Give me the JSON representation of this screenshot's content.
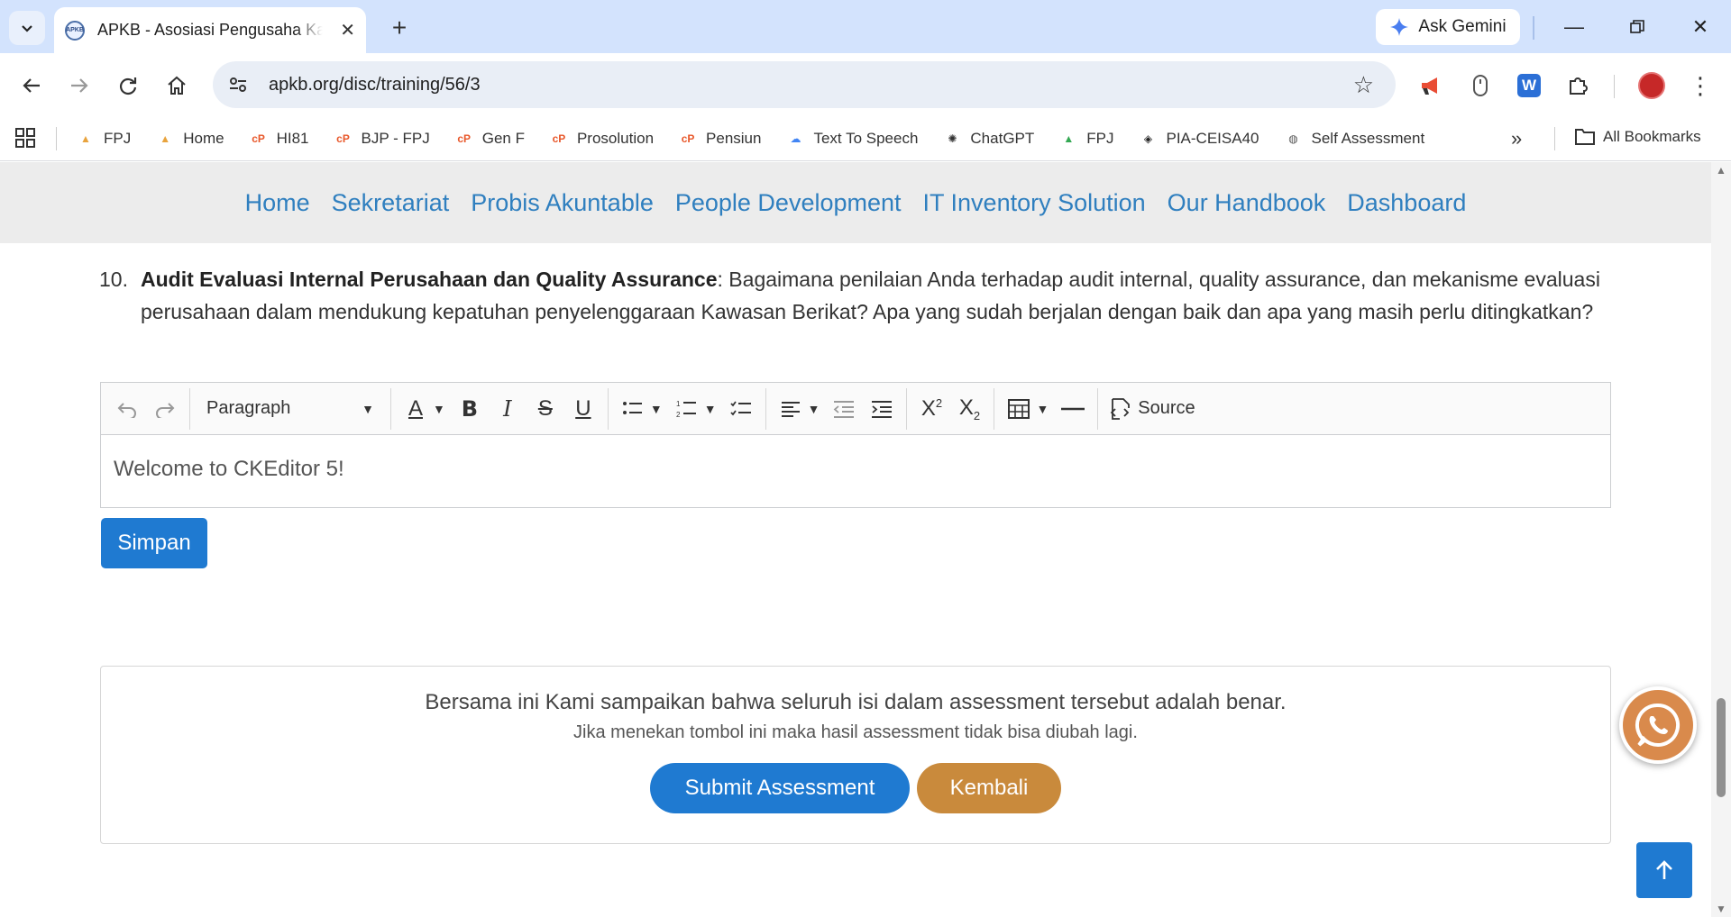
{
  "browser": {
    "tab_title": "APKB - Asosiasi Pengusaha Kawasan Berikat",
    "tab_favicon_text": "APKB",
    "ask_gemini": "Ask Gemini",
    "url": "apkb.org/disc/training/56/3",
    "ext_word_label": "W"
  },
  "bookmarks": [
    {
      "label": "FPJ",
      "icon": "pma-logo-icon",
      "color": "#e8a33d"
    },
    {
      "label": "Home",
      "icon": "pma-logo-icon",
      "color": "#e8a33d"
    },
    {
      "label": "HI81",
      "icon": "cp-logo-icon",
      "color": "#e8572a"
    },
    {
      "label": "BJP - FPJ",
      "icon": "cp-logo-icon",
      "color": "#e8572a"
    },
    {
      "label": "Gen F",
      "icon": "cp-logo-icon",
      "color": "#e8572a"
    },
    {
      "label": "Prosolution",
      "icon": "cp-logo-icon",
      "color": "#e8572a"
    },
    {
      "label": "Pensiun",
      "icon": "cp-logo-icon",
      "color": "#e8572a"
    },
    {
      "label": "Text To Speech",
      "icon": "cloud-icon",
      "color": "#4285f4"
    },
    {
      "label": "ChatGPT",
      "icon": "chatgpt-icon",
      "color": "#333333"
    },
    {
      "label": "FPJ",
      "icon": "drive-icon",
      "color": "#34a853"
    },
    {
      "label": "PIA-CEISA40",
      "icon": "layers-icon",
      "color": "#222222"
    },
    {
      "label": "Self Assessment",
      "icon": "globe-icon",
      "color": "#555555"
    }
  ],
  "bookmarks_all": "All Bookmarks",
  "nav": {
    "items": [
      "Home",
      "Sekretariat",
      "Probis Akuntable",
      "People Development",
      "IT Inventory Solution",
      "Our Handbook",
      "Dashboard"
    ]
  },
  "question": {
    "number": "10.",
    "title": "Audit Evaluasi Internal Perusahaan dan Quality Assurance",
    "body": ": Bagaimana penilaian Anda terhadap audit internal, quality assurance, dan mekanisme evaluasi perusahaan dalam mendukung kepatuhan penyelenggaraan Kawasan Berikat? Apa yang sudah berjalan dengan baik dan apa yang masih perlu ditingkatkan?"
  },
  "editor": {
    "heading_select": "Paragraph",
    "source_label": "Source",
    "content": "Welcome to CKEditor 5!"
  },
  "simpan_label": "Simpan",
  "confirm": {
    "statement": "Bersama ini Kami sampaikan bahwa seluruh isi dalam assessment tersebut adalah benar.",
    "warning": "Jika menekan tombol ini maka hasil assessment tidak bisa diubah lagi.",
    "submit_label": "Submit Assessment",
    "back_label": "Kembali"
  },
  "colors": {
    "link": "#2f7fbf",
    "primary": "#1f7ad1",
    "kembali": "#c98a3c",
    "whatsapp": "#d98a4c"
  }
}
